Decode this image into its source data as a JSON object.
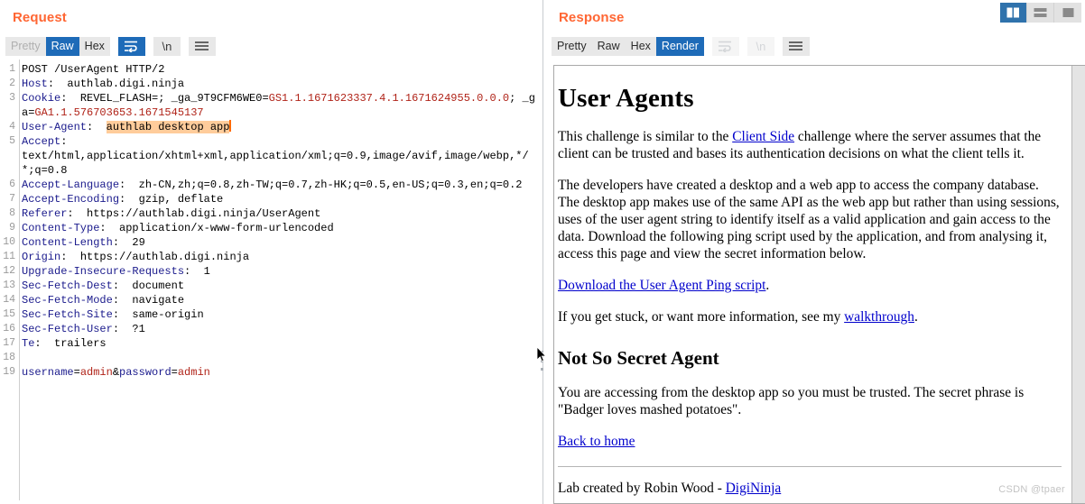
{
  "request": {
    "title": "Request",
    "toolbar": {
      "tabs": [
        {
          "label": "Pretty",
          "state": "disabled"
        },
        {
          "label": "Raw",
          "state": "active"
        },
        {
          "label": "Hex",
          "state": "normal"
        }
      ],
      "wrap_icon": "word-wrap-icon",
      "newline_label": "\\n",
      "menu_icon": "hamburger-menu-icon"
    },
    "lines": [
      {
        "n": "1",
        "segments": [
          {
            "t": "POST /UserAgent HTTP/2",
            "c": "v"
          }
        ]
      },
      {
        "n": "2",
        "segments": [
          {
            "t": "Host",
            "c": "k"
          },
          {
            "t": ":  authlab.digi.ninja",
            "c": "v"
          }
        ]
      },
      {
        "n": "3",
        "segments": [
          {
            "t": "Cookie",
            "c": "k"
          },
          {
            "t": ":  REVEL_FLASH=; _ga_9T9CFM6WE0=",
            "c": "v"
          },
          {
            "t": "GS1.1.1671623337.4.1.1671624955.0.0.0",
            "c": "rd"
          },
          {
            "t": "; _ga=",
            "c": "v"
          },
          {
            "t": "GA1.1.576703653.1671545137",
            "c": "rd"
          }
        ]
      },
      {
        "n": "4",
        "segments": [
          {
            "t": "User-Agent",
            "c": "k"
          },
          {
            "t": ":  ",
            "c": "v"
          },
          {
            "t": "authlab desktop app",
            "c": "hl"
          }
        ],
        "caret": true
      },
      {
        "n": "5",
        "segments": [
          {
            "t": "Accept",
            "c": "k"
          },
          {
            "t": ":\ntext/html,application/xhtml+xml,application/xml;q=0.9,image/avif,image/webp,*/*;q=0.8",
            "c": "v"
          }
        ]
      },
      {
        "n": "6",
        "segments": [
          {
            "t": "Accept-Language",
            "c": "k"
          },
          {
            "t": ":  zh-CN,zh;q=0.8,zh-TW;q=0.7,zh-HK;q=0.5,en-US;q=0.3,en;q=0.2",
            "c": "v"
          }
        ]
      },
      {
        "n": "7",
        "segments": [
          {
            "t": "Accept-Encoding",
            "c": "k"
          },
          {
            "t": ":  gzip, deflate",
            "c": "v"
          }
        ]
      },
      {
        "n": "8",
        "segments": [
          {
            "t": "Referer",
            "c": "k"
          },
          {
            "t": ":  https://authlab.digi.ninja/UserAgent",
            "c": "v"
          }
        ]
      },
      {
        "n": "9",
        "segments": [
          {
            "t": "Content-Type",
            "c": "k"
          },
          {
            "t": ":  application/x-www-form-urlencoded",
            "c": "v"
          }
        ]
      },
      {
        "n": "10",
        "segments": [
          {
            "t": "Content-Length",
            "c": "k"
          },
          {
            "t": ":  29",
            "c": "v"
          }
        ]
      },
      {
        "n": "11",
        "segments": [
          {
            "t": "Origin",
            "c": "k"
          },
          {
            "t": ":  https://authlab.digi.ninja",
            "c": "v"
          }
        ]
      },
      {
        "n": "12",
        "segments": [
          {
            "t": "Upgrade-Insecure-Requests",
            "c": "k"
          },
          {
            "t": ":  1",
            "c": "v"
          }
        ]
      },
      {
        "n": "13",
        "segments": [
          {
            "t": "Sec-Fetch-Dest",
            "c": "k"
          },
          {
            "t": ":  document",
            "c": "v"
          }
        ]
      },
      {
        "n": "14",
        "segments": [
          {
            "t": "Sec-Fetch-Mode",
            "c": "k"
          },
          {
            "t": ":  navigate",
            "c": "v"
          }
        ]
      },
      {
        "n": "15",
        "segments": [
          {
            "t": "Sec-Fetch-Site",
            "c": "k"
          },
          {
            "t": ":  same-origin",
            "c": "v"
          }
        ]
      },
      {
        "n": "16",
        "segments": [
          {
            "t": "Sec-Fetch-User",
            "c": "k"
          },
          {
            "t": ":  ?1",
            "c": "v"
          }
        ]
      },
      {
        "n": "17",
        "segments": [
          {
            "t": "Te",
            "c": "k"
          },
          {
            "t": ":  trailers",
            "c": "v"
          }
        ]
      },
      {
        "n": "18",
        "segments": [
          {
            "t": "",
            "c": "v"
          }
        ]
      },
      {
        "n": "19",
        "segments": [
          {
            "t": "username",
            "c": "k"
          },
          {
            "t": "=",
            "c": "v"
          },
          {
            "t": "admin",
            "c": "rd"
          },
          {
            "t": "&",
            "c": "v"
          },
          {
            "t": "password",
            "c": "k"
          },
          {
            "t": "=",
            "c": "v"
          },
          {
            "t": "admin",
            "c": "rd"
          }
        ]
      }
    ]
  },
  "response": {
    "title": "Response",
    "toolbar": {
      "tabs": [
        {
          "label": "Pretty",
          "state": "normal"
        },
        {
          "label": "Raw",
          "state": "normal"
        },
        {
          "label": "Hex",
          "state": "normal"
        },
        {
          "label": "Render",
          "state": "active"
        }
      ],
      "wrap_icon": "word-wrap-icon",
      "newline_label": "\\n",
      "menu_icon": "hamburger-menu-icon"
    },
    "render": {
      "h1": "User Agents",
      "p1_before": "This challenge is similar to the ",
      "p1_link": "Client Side",
      "p1_after": " challenge where the server assumes that the client can be trusted and bases its authentication decisions on what the client tells it.",
      "p2": "The developers have created a desktop and a web app to access the company database. The desktop app makes use of the same API as the web app but rather than using sessions, uses of the user agent string to identify itself as a valid application and gain access to the data. Download the following ping script used by the application, and from analysing it, access this page and view the secret information below.",
      "p3_link": "Download the User Agent Ping script",
      "p3_after": ".",
      "p4_before": "If you get stuck, or want more information, see my ",
      "p4_link": "walkthrough",
      "p4_after": ".",
      "h2": "Not So Secret Agent",
      "p5": "You are accessing from the desktop app so you must be trusted. The secret phrase is \"Badger loves mashed potatoes\".",
      "p6_link": "Back to home",
      "footer_before": "Lab created by Robin Wood - ",
      "footer_link": "DigiNinja"
    }
  },
  "layout_switch": {
    "buttons": [
      {
        "name": "split-vertical",
        "state": "active"
      },
      {
        "name": "split-horizontal",
        "state": "normal"
      },
      {
        "name": "single-pane",
        "state": "normal"
      }
    ]
  },
  "watermark": "CSDN @tpaer",
  "colors": {
    "accent_orange": "#ff6633",
    "active_blue": "#1e6bb8",
    "highlight_orange": "#ffcc9b",
    "link_blue": "#0000cc",
    "header_name_blue": "#1a1a8c",
    "value_red": "#b02318"
  }
}
